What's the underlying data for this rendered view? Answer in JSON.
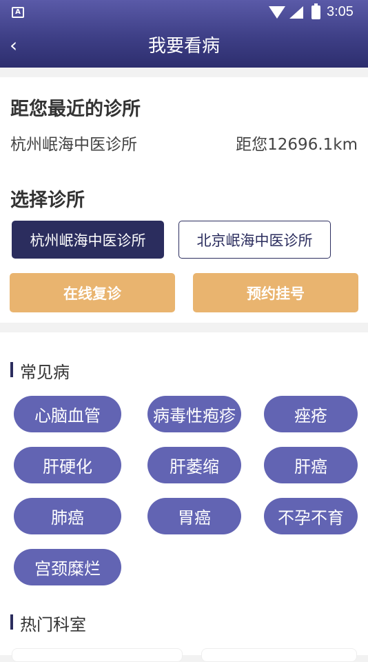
{
  "status_bar": {
    "time": "3:05",
    "app_icon_letter": "A"
  },
  "nav": {
    "back_icon": "‹",
    "title": "我要看病"
  },
  "nearest": {
    "heading": "距您最近的诊所",
    "clinic_name": "杭州岷海中医诊所",
    "distance": "距您12696.1km"
  },
  "select_clinic": {
    "heading": "选择诊所",
    "options": [
      {
        "label": "杭州岷海中医诊所",
        "selected": true
      },
      {
        "label": "北京岷海中医诊所",
        "selected": false
      }
    ]
  },
  "actions": {
    "online_revisit": "在线复诊",
    "appointment": "预约挂号"
  },
  "common_diseases": {
    "heading": "常见病",
    "items": [
      "心脑血管",
      "病毒性疱疹",
      "痤疮",
      "肝硬化",
      "肝萎缩",
      "肝癌",
      "肺癌",
      "胃癌",
      "不孕不育",
      "宫颈糜烂"
    ]
  },
  "hot_departments": {
    "heading": "热门科室"
  },
  "colors": {
    "header_top": "#5a5aa8",
    "header_bottom": "#2d2e6e",
    "primary_dark": "#2b2d5e",
    "accent_orange": "#e9b46f",
    "chip_purple": "#6264b3"
  }
}
